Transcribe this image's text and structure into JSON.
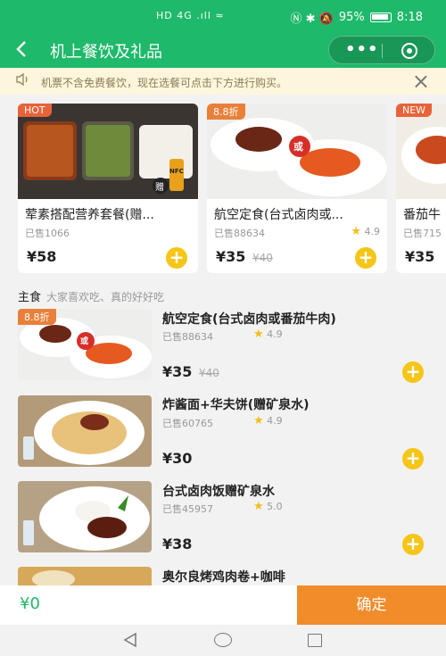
{
  "status_bar": {
    "signal": "HD 4G .ıll ≈",
    "icons": "Ⓝ ✱ 🔕",
    "battery": "95%",
    "time": "8:18"
  },
  "header": {
    "title": "机上餐饮及礼品",
    "back_icon": "chevron-left-icon",
    "more": "•••"
  },
  "notice": {
    "text": "机票不含免费餐饮，现在选餐可点击下方进行购买。"
  },
  "featured": [
    {
      "tag": "HOT",
      "name": "荤素搭配营养套餐(赠...",
      "sold": "已售1066",
      "price": "¥58",
      "old_price": "",
      "rating": ""
    },
    {
      "tag": "8.8折",
      "name": "航空定食(台式卤肉或...",
      "sold": "已售88634",
      "price": "¥35",
      "old_price": "¥40",
      "rating": "4.9"
    },
    {
      "tag": "NEW",
      "name": "番茄牛",
      "sold": "已售715",
      "price": "¥35",
      "old_price": "",
      "rating": ""
    }
  ],
  "section": {
    "title": "主食",
    "subtitle": "大家喜欢吃、真的好好吃"
  },
  "items": [
    {
      "tag": "8.8折",
      "name": "航空定食(台式卤肉或番茄牛肉)",
      "sold": "已售88634",
      "rating": "4.9",
      "price": "¥35",
      "old_price": "¥40"
    },
    {
      "tag": "",
      "name": "炸酱面+华夫饼(赠矿泉水)",
      "sold": "已售60765",
      "rating": "4.9",
      "price": "¥30",
      "old_price": ""
    },
    {
      "tag": "",
      "name": "台式卤肉饭赠矿泉水",
      "sold": "已售45957",
      "rating": "5.0",
      "price": "¥38",
      "old_price": ""
    },
    {
      "tag": "",
      "name": "奥尔良烤鸡肉卷+咖啡",
      "sold": "",
      "rating": "",
      "price": "",
      "old_price": ""
    }
  ],
  "image_text": {
    "or_badge": "或",
    "gift_badge": "赠",
    "drink_label": "NFC"
  },
  "bottom": {
    "total": "¥0",
    "confirm": "确定"
  },
  "colors": {
    "brand": "#1eb96a",
    "confirm": "#f08c2a",
    "add": "#f5c518",
    "tag": "#e8623a"
  }
}
